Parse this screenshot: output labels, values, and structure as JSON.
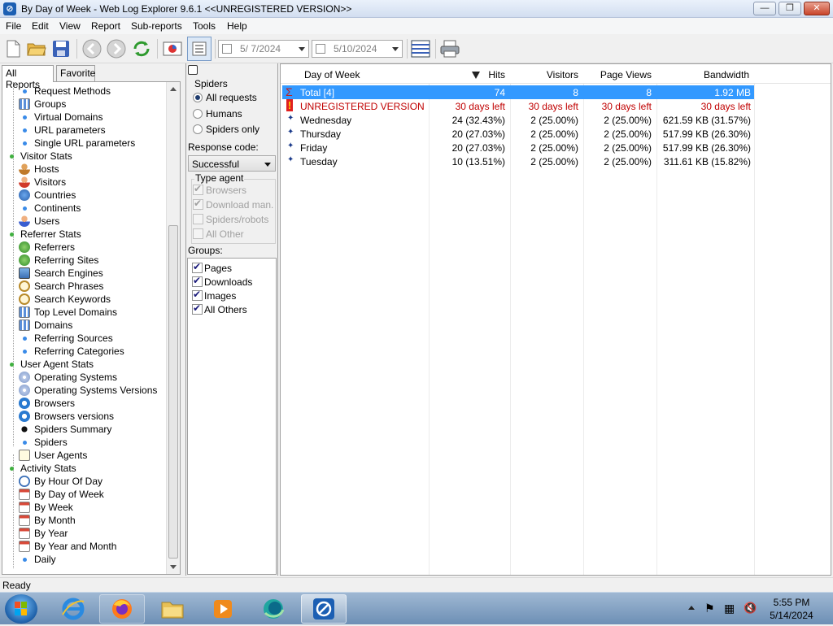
{
  "window": {
    "title": "By Day of Week - Web Log Explorer 9.6.1 <<UNREGISTERED VERSION>>",
    "minimize": "—",
    "maximize": "❐",
    "close": "✕"
  },
  "menu": [
    "File",
    "Edit",
    "View",
    "Report",
    "Sub-reports",
    "Tools",
    "Help"
  ],
  "toolbar": {
    "date_from": "5/ 7/2024",
    "date_to": "5/10/2024"
  },
  "tabs": {
    "all_reports": "All Reports",
    "favorite": "Favorite"
  },
  "tree": [
    {
      "label": "Request Methods",
      "icon": "dot"
    },
    {
      "label": "Groups",
      "icon": "grid"
    },
    {
      "label": "Virtual Domains",
      "icon": "dot"
    },
    {
      "label": "URL parameters",
      "icon": "dot"
    },
    {
      "label": "Single URL parameters",
      "icon": "dot"
    },
    {
      "label": "Visitor Stats",
      "icon": "category"
    },
    {
      "label": "Hosts",
      "icon": "user"
    },
    {
      "label": "Visitors",
      "icon": "user-red"
    },
    {
      "label": "Countries",
      "icon": "globe"
    },
    {
      "label": "Continents",
      "icon": "dot"
    },
    {
      "label": "Users",
      "icon": "user-blue"
    },
    {
      "label": "Referrer Stats",
      "icon": "category"
    },
    {
      "label": "Referrers",
      "icon": "globe-green"
    },
    {
      "label": "Referring Sites",
      "icon": "globe-green"
    },
    {
      "label": "Search Engines",
      "icon": "monitor"
    },
    {
      "label": "Search Phrases",
      "icon": "magnifier"
    },
    {
      "label": "Search Keywords",
      "icon": "magnifier"
    },
    {
      "label": "Top Level Domains",
      "icon": "grid"
    },
    {
      "label": "Domains",
      "icon": "grid"
    },
    {
      "label": "Referring Sources",
      "icon": "dot"
    },
    {
      "label": "Referring Categories",
      "icon": "dot"
    },
    {
      "label": "User Agent Stats",
      "icon": "category"
    },
    {
      "label": "Operating Systems",
      "icon": "disc"
    },
    {
      "label": "Operating Systems Versions",
      "icon": "disc"
    },
    {
      "label": "Browsers",
      "icon": "ie"
    },
    {
      "label": "Browsers versions",
      "icon": "ie"
    },
    {
      "label": "Spiders Summary",
      "icon": "spider"
    },
    {
      "label": "Spiders",
      "icon": "dot"
    },
    {
      "label": "User Agents",
      "icon": "doc"
    },
    {
      "label": "Activity Stats",
      "icon": "category"
    },
    {
      "label": "By Hour Of Day",
      "icon": "clock"
    },
    {
      "label": "By Day of Week",
      "icon": "calendar"
    },
    {
      "label": "By Week",
      "icon": "calendar"
    },
    {
      "label": "By Month",
      "icon": "calendar"
    },
    {
      "label": "By Year",
      "icon": "calendar"
    },
    {
      "label": "By Year and Month",
      "icon": "calendar"
    },
    {
      "label": "Daily",
      "icon": "dot"
    }
  ],
  "filters": {
    "spiders_label": "Spiders",
    "all_requests": "All requests",
    "humans": "Humans",
    "spiders_only": "Spiders only",
    "response_code_label": "Response code:",
    "response_code_value": "Successful",
    "type_agent_label": "Type agent",
    "browsers": "Browsers",
    "download_man": "Download man.",
    "spiders_robots": "Spiders/robots",
    "all_other": "All Other",
    "groups_label": "Groups:",
    "groups": [
      "Pages",
      "Downloads",
      "Images",
      "All Others"
    ]
  },
  "table": {
    "headers": {
      "day": "Day of Week",
      "hits": "Hits",
      "visitors": "Visitors",
      "page_views": "Page Views",
      "bandwidth": "Bandwidth"
    },
    "rows": [
      {
        "kind": "total",
        "day": "Total [4]",
        "hits": "74",
        "visitors": "8",
        "page_views": "8",
        "bandwidth": "1.92 MB"
      },
      {
        "kind": "unreg",
        "day": "UNREGISTERED VERSION",
        "hits": "30 days left",
        "visitors": "30 days left",
        "page_views": "30 days left",
        "bandwidth": "30 days left"
      },
      {
        "kind": "data",
        "day": "Wednesday",
        "hits": "24 (32.43%)",
        "visitors": "2 (25.00%)",
        "page_views": "2 (25.00%)",
        "bandwidth": "621.59 KB (31.57%)"
      },
      {
        "kind": "data",
        "day": "Thursday",
        "hits": "20 (27.03%)",
        "visitors": "2 (25.00%)",
        "page_views": "2 (25.00%)",
        "bandwidth": "517.99 KB (26.30%)"
      },
      {
        "kind": "data",
        "day": "Friday",
        "hits": "20 (27.03%)",
        "visitors": "2 (25.00%)",
        "page_views": "2 (25.00%)",
        "bandwidth": "517.99 KB (26.30%)"
      },
      {
        "kind": "data",
        "day": "Tuesday",
        "hits": "10 (13.51%)",
        "visitors": "2 (25.00%)",
        "page_views": "2 (25.00%)",
        "bandwidth": "311.61 KB (15.82%)"
      }
    ]
  },
  "status": "Ready",
  "taskbar": {
    "time": "5:55 PM",
    "date": "5/14/2024"
  }
}
